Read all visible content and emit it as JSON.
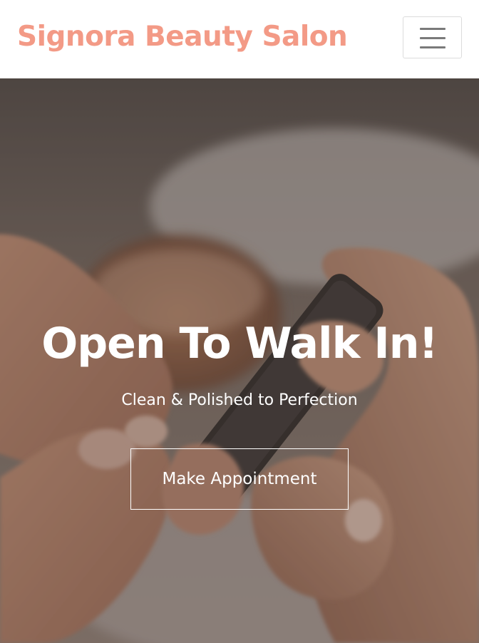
{
  "navbar": {
    "brand": "Signora Beauty Salon",
    "menu_icon": "hamburger-menu-icon",
    "brand_color": "#f39a86"
  },
  "hero": {
    "title": "Open To Walk In!",
    "subtitle": "Clean & Polished to Perfection",
    "cta_label": "Make Appointment",
    "background_image": "manicure-nail-file-photo"
  }
}
